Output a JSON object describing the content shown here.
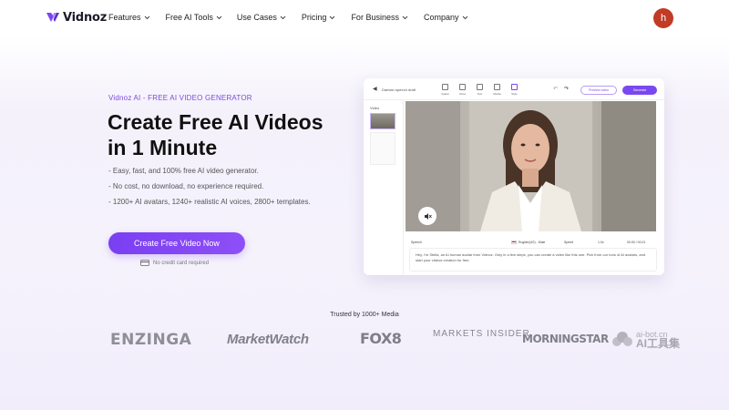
{
  "nav": {
    "brand": "Vidnoz",
    "items": [
      {
        "label": "Features"
      },
      {
        "label": "Free AI Tools"
      },
      {
        "label": "Use Cases"
      },
      {
        "label": "Pricing"
      },
      {
        "label": "For Business"
      },
      {
        "label": "Company"
      }
    ],
    "avatar_letter": "h",
    "avatar_color": "#c23b24"
  },
  "hero": {
    "eyebrow": "Vidnoz AI - FREE AI VIDEO GENERATOR",
    "headline_line1": "Create Free AI Videos",
    "headline_line2": "in 1 Minute",
    "bullets": [
      "- Easy, fast, and 100% free AI video generator.",
      "- No cost, no download, no experience required.",
      "- 1200+ AI avatars, 1240+ realistic AI voices, 2800+ templates."
    ],
    "cta_label": "Create Free Video Now",
    "no_card_text": "No credit card required",
    "accent_color": "#7b47f0"
  },
  "editor": {
    "project_name": "Damian speech draft",
    "tools": [
      "Avatar",
      "Voice",
      "Text",
      "Media",
      "Style"
    ],
    "preview_label": "Preview video",
    "generate_label": "Generate",
    "side_label": "Video",
    "speech_label": "Speech",
    "voice_label": "English(US) - Male",
    "speed_label": "Speed",
    "rate_value": "1.0x",
    "time_value": "00:00 / 00:21",
    "script_text": "Hey, I'm Stella, an AI human avatar from Vidnoz. Only in a few steps, you can create a video like this one. Pick from our tons of AI avatars, and start your videos creation for free."
  },
  "trusted": {
    "heading": "Trusted by 1000+ Media",
    "logos": [
      "ENZINGA",
      "MarketWatch",
      "FOX8",
      "MARKETS INSIDER",
      "MORNINGSTAR",
      "ai-bot.cn",
      "AI工具集"
    ]
  }
}
